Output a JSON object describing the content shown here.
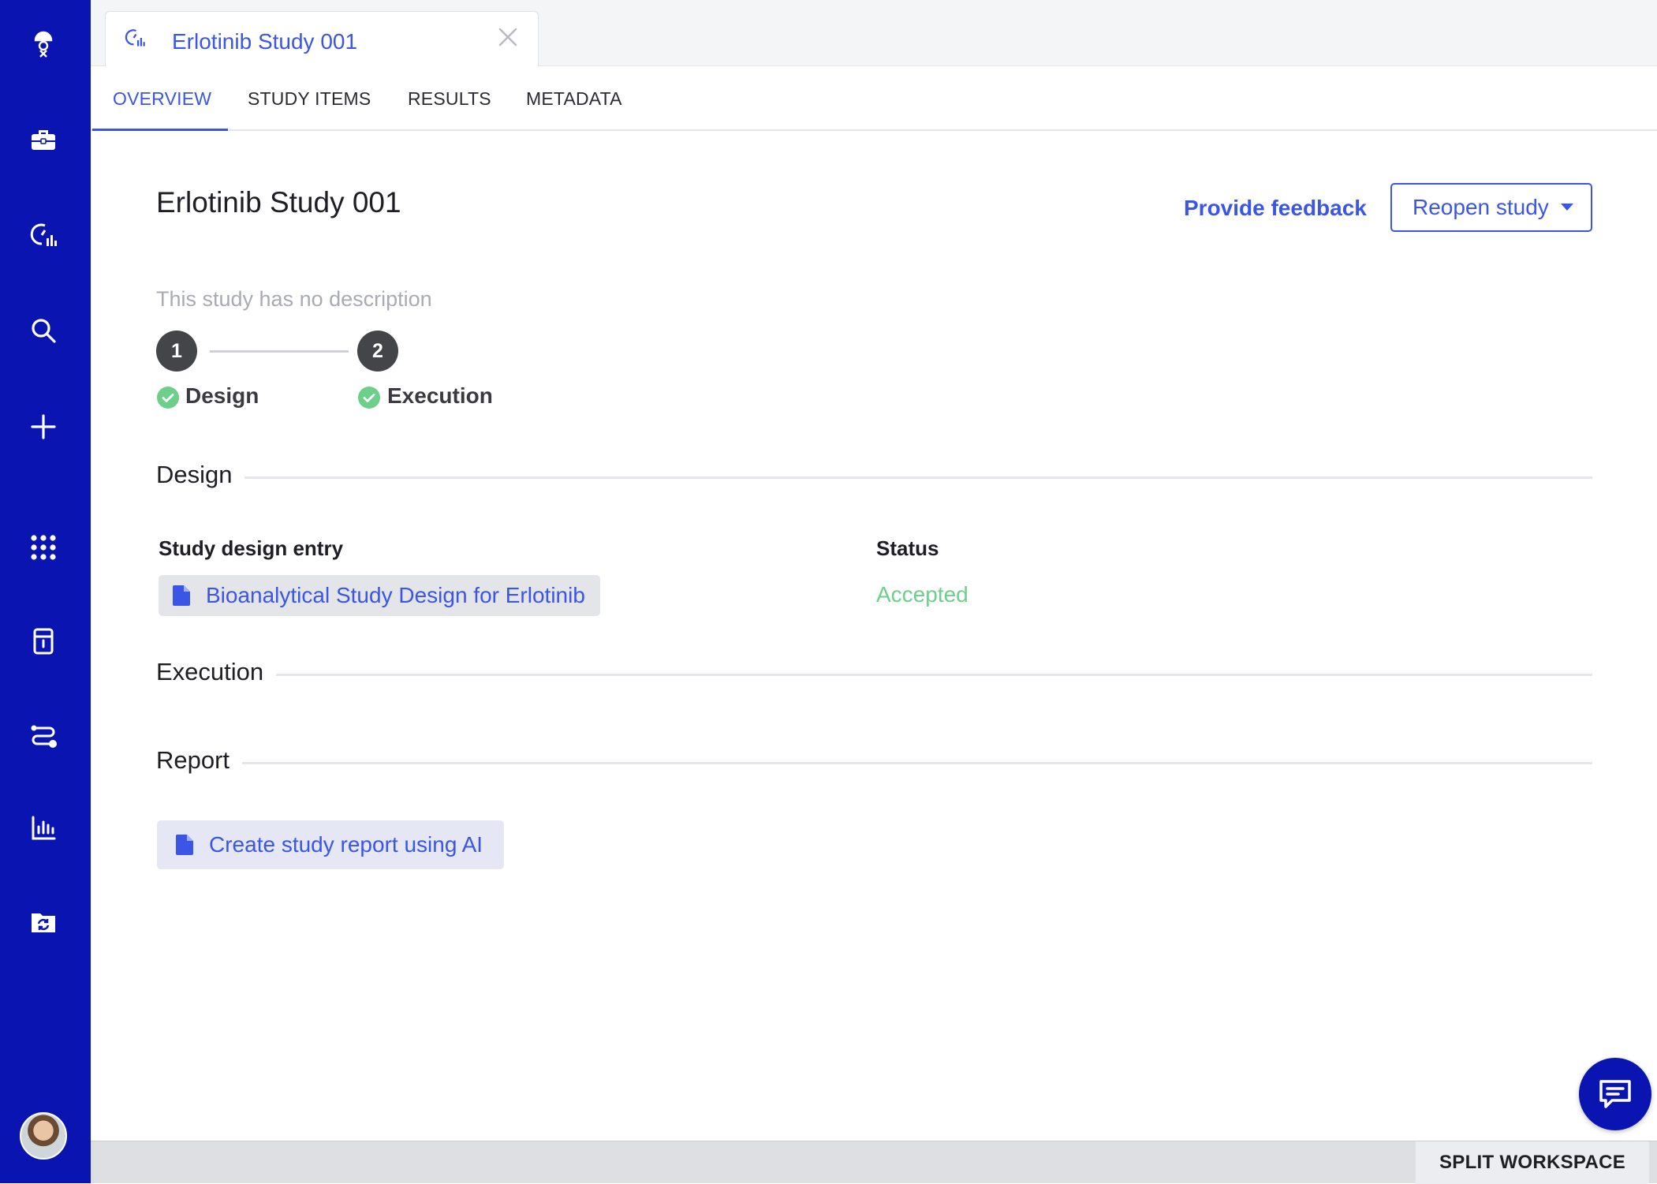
{
  "colors": {
    "rail_bg": "#0a14b0",
    "accent": "#3b55e6",
    "success": "#6ccf8a",
    "muted_text": "#a9abb2",
    "step_circle": "#444548"
  },
  "rail": {
    "icons": [
      "app-logo-icon",
      "briefcase-icon",
      "study-gauge-icon",
      "search-icon",
      "plus-icon",
      "apps-grid-icon",
      "inventory-icon",
      "workflow-icon",
      "bar-chart-icon",
      "folder-sync-icon"
    ],
    "avatar": "user-avatar"
  },
  "doc_tab": {
    "title": "Erlotinib Study 001",
    "icon": "study-gauge-icon"
  },
  "page_tabs": [
    {
      "label": "OVERVIEW",
      "active": true
    },
    {
      "label": "STUDY ITEMS",
      "active": false
    },
    {
      "label": "RESULTS",
      "active": false
    },
    {
      "label": "METADATA",
      "active": false
    }
  ],
  "header": {
    "title": "Erlotinib Study 001",
    "feedback_label": "Provide feedback",
    "reopen_label": "Reopen study"
  },
  "description": "This study has no description",
  "steps": [
    {
      "number": "1",
      "label": "Design",
      "complete": true
    },
    {
      "number": "2",
      "label": "Execution",
      "complete": true
    }
  ],
  "design": {
    "section_title": "Design",
    "col_entry_label": "Study design entry",
    "col_status_label": "Status",
    "entry_label": "Bioanalytical Study Design for Erlotinib",
    "status_value": "Accepted"
  },
  "execution": {
    "section_title": "Execution"
  },
  "report": {
    "section_title": "Report",
    "ai_button_label": "Create study report using AI"
  },
  "bottom_bar": {
    "split_label": "SPLIT WORKSPACE"
  }
}
